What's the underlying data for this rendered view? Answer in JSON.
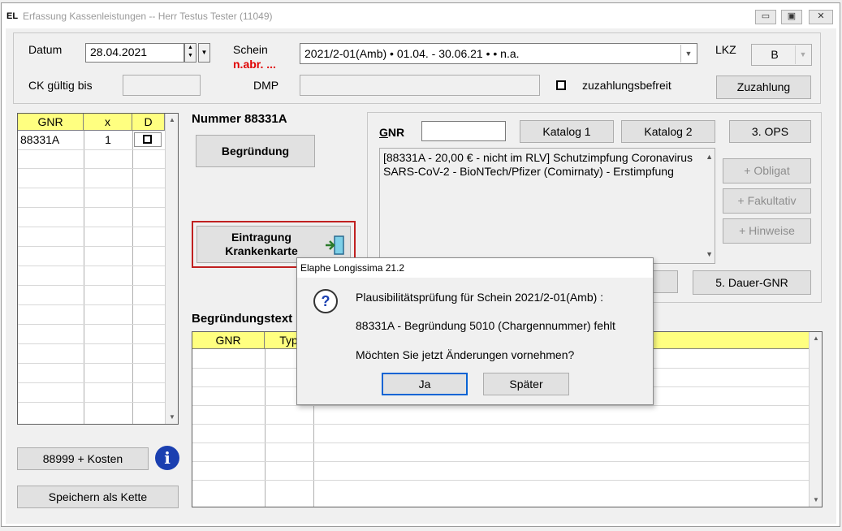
{
  "window": {
    "title": "Erfassung Kassenleistungen --  Herr Testus Tester (11049)",
    "minimize_glyph": "▭",
    "maximize_glyph": "▣",
    "close_glyph": "✕"
  },
  "header": {
    "datum_label": "Datum",
    "datum_value": "28.04.2021",
    "schein_label": "Schein",
    "schein_status": "n.abr. ...",
    "schein_value": "2021/2-01(Amb) • 01.04. - 30.06.21 •   • n.a.",
    "lkz_label": "LKZ",
    "lkz_value": "B",
    "ck_label": "CK gültig bis",
    "dmp_label": "DMP",
    "zuzahlungsbefreit_label": "zuzahlungsbefreit",
    "zuzahlung_button": "Zuzahlung"
  },
  "gnr_table": {
    "headers": [
      "GNR",
      "x",
      "D"
    ],
    "rows": [
      {
        "gnr": "88331A",
        "x": "1",
        "d": ""
      }
    ]
  },
  "middle": {
    "nummer_title": "Nummer 88331A",
    "begruendung_button": "Begründung",
    "eintragung_line1": "Eintragung",
    "eintragung_line2": "Krankenkarte",
    "begruendungstext_title": "Begründungstext"
  },
  "catalog": {
    "gnr_label": "GNR",
    "gnr_input": "",
    "katalog1_button": "Katalog 1",
    "katalog2_button": "Katalog 2",
    "ops_button": "3. OPS",
    "description": "[88331A - 20,00 € - nicht im RLV]  Schutzimpfung Coronavirus SARS-CoV-2 - BioNTech/Pfizer (Comirnaty) - Erstimpfung",
    "obligat_button": "+ Obligat",
    "fakultativ_button": "+ Fakultativ",
    "hinweise_button": "+ Hinweise",
    "dauer_gnr_button": "5. Dauer-GNR"
  },
  "begruendung_table": {
    "headers": [
      "GNR",
      "Typ",
      ""
    ]
  },
  "bottom": {
    "kosten_button": "88999 + Kosten",
    "speichern_button": "Speichern als Kette"
  },
  "dialog": {
    "title": "Elaphe Longissima 21.2",
    "line1": "Plausibilitätsprüfung für Schein 2021/2-01(Amb) :",
    "line2": "88331A - Begründung 5010 (Chargennummer) fehlt",
    "line3": "Möchten Sie jetzt Änderungen vornehmen?",
    "yes_button": "Ja",
    "later_button": "Später"
  },
  "colors": {
    "header_yellow": "#ffff80",
    "status_red": "#e00000",
    "info_blue": "#1a3fb0"
  }
}
